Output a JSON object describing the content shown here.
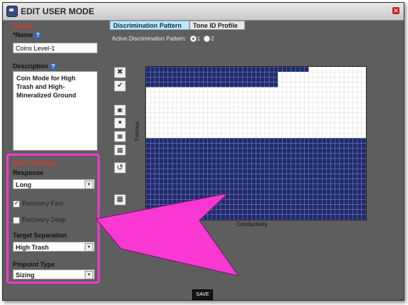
{
  "window": {
    "title": "EDIT USER MODE",
    "close_label": "✕"
  },
  "details": {
    "section_label": "Details",
    "name_label": "*Name",
    "name_value": "Coins Level-1",
    "description_label": "Description",
    "description_value": "Coin Mode for High Trash and High-Mineralized Ground"
  },
  "mode_settings": {
    "section_label": "Mode Settings",
    "response_label": "Response",
    "response_value": "Long",
    "recovery_fast_label": "Recovery Fast",
    "recovery_fast_checked": true,
    "recovery_deep_label": "Recovery Deep",
    "recovery_deep_checked": false,
    "target_separation_label": "Target Separation",
    "target_separation_value": "High Trash",
    "pinpoint_type_label": "Pinpoint Type",
    "pinpoint_type_value": "Sizing"
  },
  "tabs": [
    {
      "label": "Discrimination Pattern",
      "active": true
    },
    {
      "label": "Tone ID Profile",
      "active": false
    }
  ],
  "pattern": {
    "active_label": "Active Discrimination Pattern:",
    "options": [
      "1",
      "2"
    ],
    "selected": "1",
    "x_axis_label": "Conductivity",
    "y_axis_label": "Ferrous"
  },
  "grid": {
    "rows": 30,
    "cols": 50,
    "filled_color": "#1f2a6e",
    "empty_color": "#ffffff",
    "row_fill_counts_top": [
      37,
      30,
      30,
      30
    ]
  },
  "actions": {
    "save_label": "SAVE"
  },
  "colors": {
    "highlight": "#ff38d6",
    "section_label": "#d93a30",
    "tab_active": "#bfe8f6"
  }
}
